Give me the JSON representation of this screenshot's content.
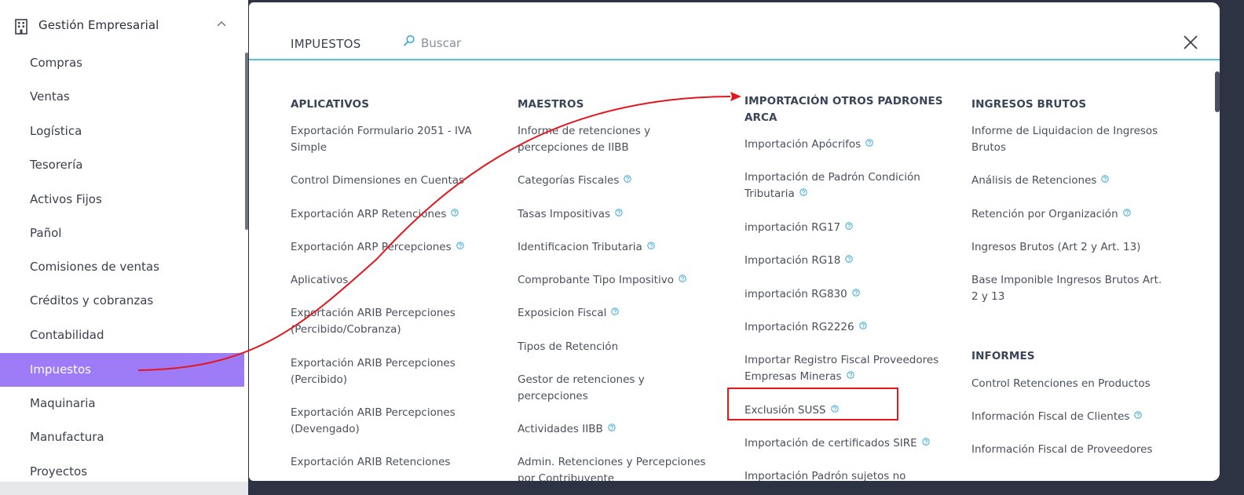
{
  "sidebar": {
    "header": "Gestión Empresarial",
    "items": [
      "Compras",
      "Ventas",
      "Logística",
      "Tesorería",
      "Activos Fijos",
      "Pañol",
      "Comisiones de ventas",
      "Créditos y cobranzas",
      "Contabilidad",
      "Impuestos",
      "Maquinaria",
      "Manufactura",
      "Proyectos"
    ],
    "active": "Impuestos"
  },
  "panel": {
    "title": "IMPUESTOS",
    "search_placeholder": "Buscar",
    "columns": [
      {
        "sections": [
          {
            "title": "APLICATIVOS",
            "items": [
              {
                "label": "Exportación Formulario 2051 - IVA\nSimple",
                "help": false
              },
              {
                "label": "Control Dimensiones en Cuentas",
                "help": false
              },
              {
                "label": "Exportación ARP Retenciones",
                "help": true
              },
              {
                "label": "Exportación ARP Percepciones",
                "help": true
              },
              {
                "label": "Aplicativos",
                "help": false
              },
              {
                "label": "Exportación ARIB Percepciones\n(Percibido/Cobranza)",
                "help": false
              },
              {
                "label": "Exportación ARIB Percepciones\n(Percibido)",
                "help": false
              },
              {
                "label": "Exportación ARIB Percepciones\n(Devengado)",
                "help": false
              },
              {
                "label": "Exportación ARIB Retenciones",
                "help": false
              }
            ]
          }
        ]
      },
      {
        "sections": [
          {
            "title": "MAESTROS",
            "items": [
              {
                "label": "Informe de retenciones y\npercepciones de IIBB",
                "help": false
              },
              {
                "label": "Categorías Fiscales",
                "help": true
              },
              {
                "label": "Tasas Impositivas",
                "help": true
              },
              {
                "label": "Identificacion Tributaria",
                "help": true
              },
              {
                "label": "Comprobante Tipo Impositivo",
                "help": true
              },
              {
                "label": "Exposicion Fiscal",
                "help": true
              },
              {
                "label": "Tipos de Retención",
                "help": false
              },
              {
                "label": "Gestor de retenciones y\npercepciones",
                "help": false
              },
              {
                "label": "Actividades IIBB",
                "help": true
              },
              {
                "label": "Admin. Retenciones y Percepciones\npor Contribuyente",
                "help": false
              }
            ]
          }
        ]
      },
      {
        "sections": [
          {
            "title": "IMPORTACIÓN OTROS PADRONES\nARCA",
            "items": [
              {
                "label": "Importación Apócrifos",
                "help": true
              },
              {
                "label": "Importación de Padrón Condición\nTributaria",
                "help": true
              },
              {
                "label": "importación RG17",
                "help": true
              },
              {
                "label": "Importación RG18",
                "help": true
              },
              {
                "label": "importación RG830",
                "help": true
              },
              {
                "label": "Importación RG2226",
                "help": true
              },
              {
                "label": "Importar Registro Fiscal Proveedores\nEmpresas Mineras",
                "help": true
              },
              {
                "label": "Exclusión SUSS",
                "help": true
              },
              {
                "label": "Importación de certificados SIRE",
                "help": true
              },
              {
                "label": "Importación Padrón sujetos no",
                "help": false
              }
            ]
          }
        ]
      },
      {
        "sections": [
          {
            "title": "INGRESOS BRUTOS",
            "items": [
              {
                "label": "Informe de Liquidacion de Ingresos\nBrutos",
                "help": false
              },
              {
                "label": "Análisis de Retenciones",
                "help": true
              },
              {
                "label": "Retención por Organización",
                "help": true
              },
              {
                "label": "Ingresos Brutos (Art 2 y Art. 13)",
                "help": false
              },
              {
                "label": "Base Imponible Ingresos Brutos Art.\n2 y 13",
                "help": false
              }
            ]
          },
          {
            "title": "INFORMES",
            "items": [
              {
                "label": "Control Retenciones en Productos",
                "help": false
              },
              {
                "label": "Información Fiscal de Clientes",
                "help": true
              },
              {
                "label": "Información Fiscal de Proveedores",
                "help": false
              }
            ]
          }
        ]
      }
    ]
  },
  "colors": {
    "accent": "#9e7cf7",
    "search_underline": "#56c1da",
    "help_icon": "#3aa8d8",
    "annotation": "#e3161e"
  }
}
